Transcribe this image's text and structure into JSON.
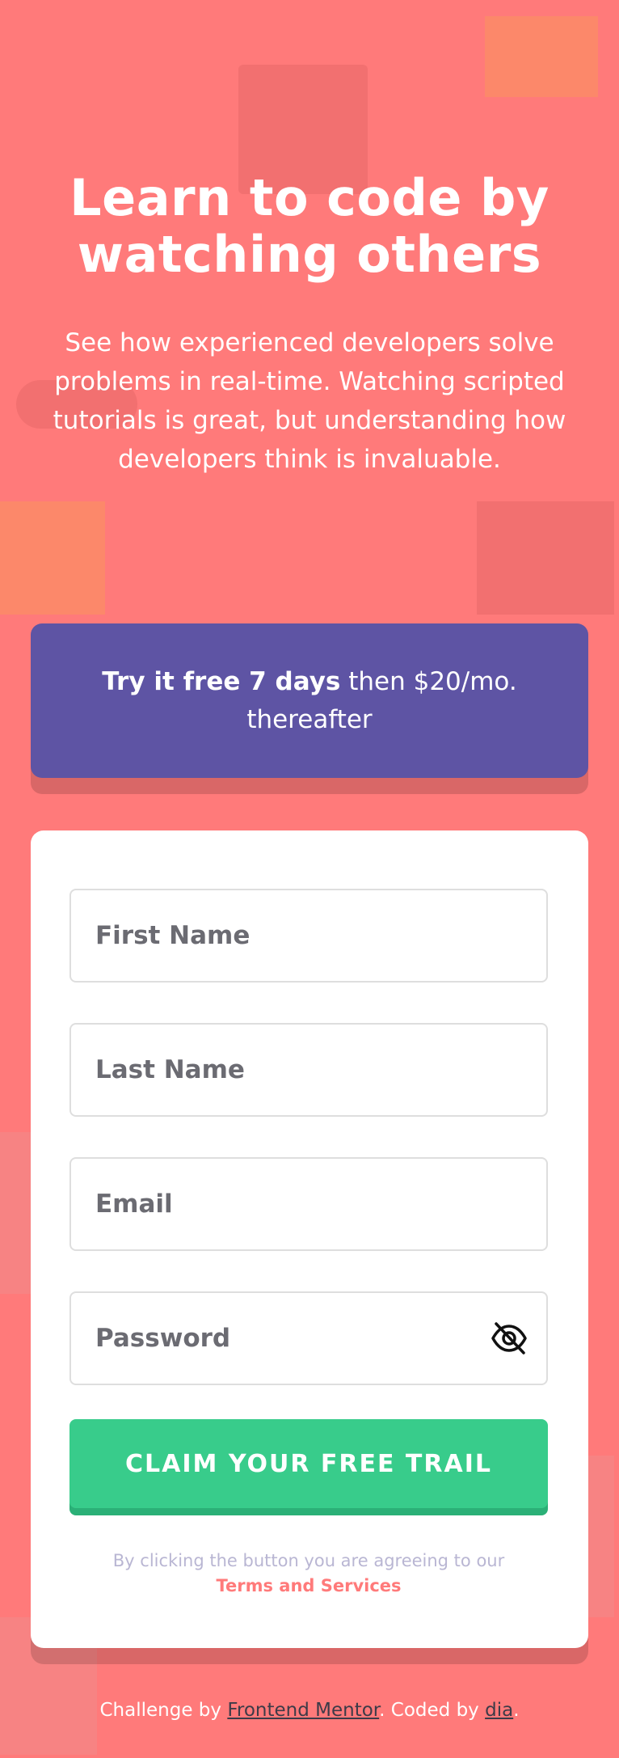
{
  "hero": {
    "title_line1": "Learn to code by",
    "title_line2": "watching others",
    "text": "See how experienced developers solve problems in real-time. Watching scripted tutorials is great, but understanding how developers think is invaluable."
  },
  "promo": {
    "bold": "Try it free 7 days",
    "rest": " then $20/mo. thereafter"
  },
  "form": {
    "first_name_placeholder": "First Name",
    "last_name_placeholder": "Last Name",
    "email_placeholder": "Email",
    "password_placeholder": "Password",
    "submit_label": "CLAIM YOUR FREE TRAIL",
    "terms_prefix": "By clicking the button you are agreeing to our",
    "terms_link": "Terms and Services",
    "password_toggle_icon": "eye-off-icon"
  },
  "footer": {
    "prefix": "Challenge by ",
    "mentor_link": "Frontend Mentor",
    "middle": ". Coded by ",
    "author_link": "dia",
    "suffix": "."
  },
  "colors": {
    "background": "#ff7a7a",
    "promo": "#5e54a4",
    "cta": "#38cc8b",
    "terms_link": "#ff7a7a"
  }
}
